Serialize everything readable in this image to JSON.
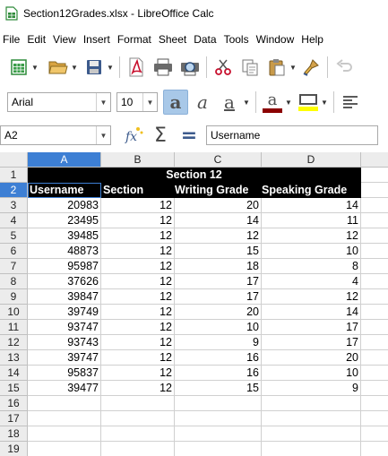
{
  "window": {
    "title": "Section12Grades.xlsx - LibreOffice Calc"
  },
  "menu": [
    "File",
    "Edit",
    "View",
    "Insert",
    "Format",
    "Sheet",
    "Data",
    "Tools",
    "Window",
    "Help"
  ],
  "toolbar": {
    "font_name": "Arial",
    "font_size": "10"
  },
  "formula_bar": {
    "cell_ref": "A2",
    "content": "Username"
  },
  "columns": [
    "A",
    "B",
    "C",
    "D"
  ],
  "selected_column": "A",
  "selected_row": 2,
  "sheet": {
    "title": "Section 12",
    "headers": [
      "Username",
      "Section",
      "Writing Grade",
      "Speaking Grade"
    ],
    "rows": [
      [
        "20983",
        "12",
        "20",
        "14"
      ],
      [
        "23495",
        "12",
        "14",
        "11"
      ],
      [
        "39485",
        "12",
        "12",
        "12"
      ],
      [
        "48873",
        "12",
        "15",
        "10"
      ],
      [
        "95987",
        "12",
        "18",
        "8"
      ],
      [
        "37626",
        "12",
        "17",
        "4"
      ],
      [
        "39847",
        "12",
        "17",
        "12"
      ],
      [
        "39749",
        "12",
        "20",
        "14"
      ],
      [
        "93747",
        "12",
        "10",
        "17"
      ],
      [
        "93743",
        "12",
        "9",
        "17"
      ],
      [
        "39747",
        "12",
        "16",
        "20"
      ],
      [
        "95837",
        "12",
        "16",
        "10"
      ],
      [
        "39477",
        "12",
        "15",
        "9"
      ]
    ]
  },
  "row_numbers": [
    "1",
    "2",
    "3",
    "4",
    "5",
    "6",
    "7",
    "8",
    "9",
    "10",
    "11",
    "12",
    "13",
    "14",
    "15",
    "16",
    "17",
    "18",
    "19"
  ],
  "icons": {
    "toolbar1": [
      "new-spreadsheet-icon",
      "open-folder-icon",
      "save-icon",
      "export-pdf-icon",
      "print-icon",
      "print-preview-icon",
      "cut-icon",
      "copy-icon",
      "paste-icon",
      "clone-formatting-icon",
      "undo-icon"
    ],
    "toolbar2": [
      "bold-icon",
      "italic-icon",
      "underline-icon",
      "font-color-icon",
      "highlight-color-icon",
      "align-left-icon"
    ],
    "formula": [
      "function-wizard-icon",
      "sum-icon",
      "formula-icon"
    ]
  },
  "colors": {
    "selection": "#3d7fd4",
    "header_fill": "#000000",
    "font_color_bar": "#8b0000",
    "highlight_bar": "#ffff00"
  }
}
